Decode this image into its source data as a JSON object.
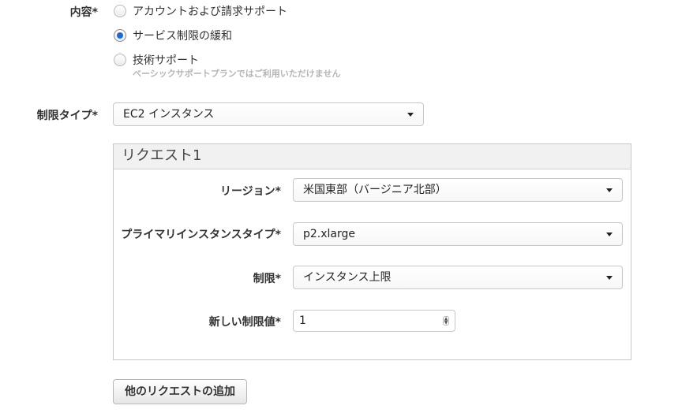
{
  "content_section": {
    "label": "内容*",
    "options": [
      {
        "label": "アカウントおよび請求サポート",
        "selected": false
      },
      {
        "label": "サービス制限の緩和",
        "selected": true
      },
      {
        "label": "技術サポート",
        "selected": false,
        "hint": "ベーシックサポートプランではご利用いただけません"
      }
    ]
  },
  "limit_type": {
    "label": "制限タイプ*",
    "value": "EC2 インスタンス"
  },
  "request": {
    "title": "リクエスト1",
    "region": {
      "label": "リージョン*",
      "value": "米国東部（バージニア北部）"
    },
    "instance_type": {
      "label": "プライマリインスタンスタイプ*",
      "value": "p2.xlarge"
    },
    "limit": {
      "label": "制限*",
      "value": "インスタンス上限"
    },
    "new_limit": {
      "label": "新しい制限値*",
      "value": "1"
    }
  },
  "add_request_button": "他のリクエストの追加",
  "colors": {
    "accent": "#1b6ad6"
  }
}
